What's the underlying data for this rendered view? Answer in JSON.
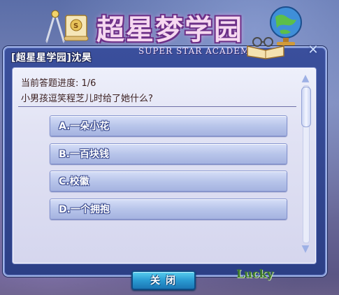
{
  "header": {
    "title": "[超星星学园]沈昊",
    "close_icon": "close-x-icon"
  },
  "logo": {
    "title": "超星梦学园",
    "subtitle": "SUPER STAR ACADEMY"
  },
  "quiz": {
    "progress": "当前答题进度: 1/6",
    "question": "小男孩逗笑程芝儿时给了她什么?",
    "options": [
      {
        "label": "A.一朵小花"
      },
      {
        "label": "B.一百块钱"
      },
      {
        "label": "C.校徽"
      },
      {
        "label": "D.一个拥抱"
      }
    ]
  },
  "footer": {
    "close_label": "关闭",
    "lucky": "Lucky"
  },
  "colors": {
    "frame": "#2c3f86",
    "panel": "#e2e3f4",
    "option": "#b8c5ea",
    "close_button": "#2a9bd2"
  }
}
